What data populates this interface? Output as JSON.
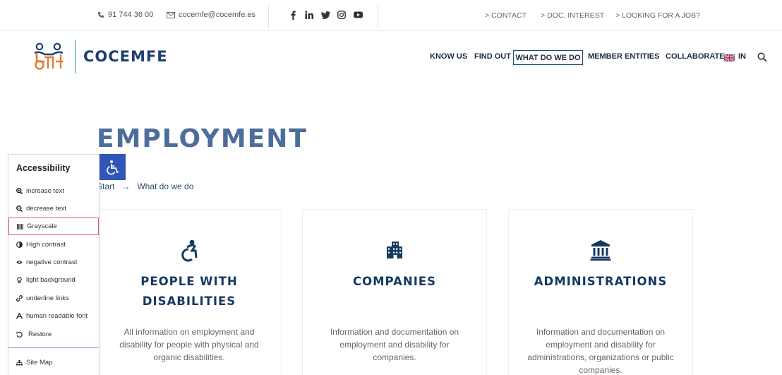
{
  "topbar": {
    "phone": "91 744 36 00",
    "email": "cocemfe@cocemfe.es",
    "links": [
      "CONTACT",
      "DOC. INTEREST",
      "LOOKING FOR A JOB?"
    ],
    "link_prefix": ">"
  },
  "header": {
    "logo_text": "COCEMFE",
    "nav": [
      "KNOW US",
      "FIND OUT",
      "WHAT DO WE DO",
      "MEMBER ENTITIES",
      "COLLABORATE"
    ],
    "language": "IN"
  },
  "page": {
    "title": "EMPLOYMENT",
    "breadcrumb": [
      "Start",
      "→",
      "What do we do"
    ]
  },
  "cards": [
    {
      "title": "PEOPLE WITH DISABILITIES",
      "title_lines": [
        "PEOPLE WITH",
        "DISABILITIES"
      ],
      "desc_lines": [
        "All information on employment and",
        "disability for people with physical and",
        "organic disabilities."
      ],
      "icon": "wheelchair-active-icon"
    },
    {
      "title": "COMPANIES",
      "title_lines": [
        "COMPANIES"
      ],
      "desc_lines": [
        "Information and documentation on",
        "employment and disability for",
        "companies."
      ],
      "icon": "building-icon"
    },
    {
      "title": "ADMINISTRATIONS",
      "title_lines": [
        "ADMINISTRATIONS"
      ],
      "desc_lines": [
        "Information and documentation on",
        "employment and disability for",
        "administrations, organizations or public",
        "companies."
      ],
      "icon": "institution-icon"
    }
  ],
  "accessibility": {
    "title": "Accessibility",
    "items": [
      {
        "label": "increase text",
        "icon": "zoom-in-icon"
      },
      {
        "label": "decrease text",
        "icon": "zoom-out-icon"
      },
      {
        "label": "Grayscale",
        "icon": "barcode-icon"
      },
      {
        "label": "High contrast",
        "icon": "contrast-icon"
      },
      {
        "label": "negative contrast",
        "icon": "eye-icon"
      },
      {
        "label": "light background",
        "icon": "bulb-icon"
      },
      {
        "label": "underline links",
        "icon": "link-icon"
      },
      {
        "label": "human readable font",
        "icon": "font-icon"
      },
      {
        "label": "Restore",
        "icon": "restore-icon"
      }
    ],
    "sitemap": "Site Map"
  },
  "colors": {
    "brand_navy": "#1f3f6e",
    "brand_teal": "#2aa1a8",
    "title_blue": "#4d6d9a",
    "card_title": "#153a62",
    "accessibility_button": "#2f56b8",
    "highlight": "#e05a5a"
  }
}
